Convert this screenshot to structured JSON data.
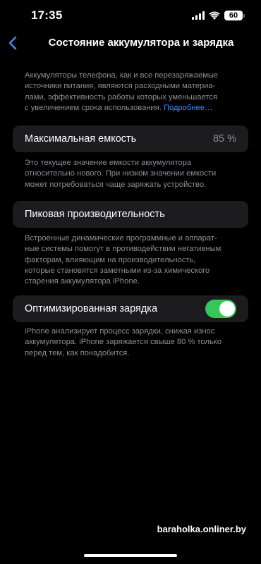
{
  "status_bar": {
    "time": "17:35",
    "battery_level": "60",
    "icons": [
      "signal-icon",
      "wifi-icon",
      "battery-icon"
    ]
  },
  "nav": {
    "back_icon": "chevron-left-icon",
    "title": "Состояние аккумулятора и зарядка"
  },
  "intro": {
    "line1": "Аккумуляторы телефона, как и все перезаряжаемые",
    "line2": "источники питания, являются расходными материа-",
    "line3": "лами, эффективность работы которых уменьшается",
    "line4_text": "с увеличением срока использования.",
    "link": "Подробнее…"
  },
  "max_capacity": {
    "label": "Максимальная емкость",
    "value": "85 %",
    "footnote_line1": "Это текущее значение емкости аккумулятора",
    "footnote_line2": "относительно нового. При низком значении емкости",
    "footnote_line3": "может потребоваться чаще заряжать устройство."
  },
  "peak_performance": {
    "label": "Пиковая производительность",
    "footnote_line1": "Встроенные динамические программные и аппарат-",
    "footnote_line2": "ные системы помогут в противодействии негативным",
    "footnote_line3": "факторам, влияющим на производительность,",
    "footnote_line4": "которые становятся заметными из-за химического",
    "footnote_line5": "старения аккумулятора iPhone."
  },
  "optimized_charging": {
    "label": "Оптимизированная зарядка",
    "enabled": true,
    "footnote_line1": "iPhone анализирует процесс зарядки, снижая износ",
    "footnote_line2": "аккумулятора. iPhone заряжается свыше 80 % только",
    "footnote_line3": "перед тем, как понадобится."
  },
  "watermark": "baraholka.onliner.by",
  "colors": {
    "background": "#000000",
    "card": "#1c1c1e",
    "secondary_text": "#8d8d93",
    "link": "#3d8cf4",
    "toggle_on": "#34c759",
    "back_chevron": "#3d8cf4"
  }
}
